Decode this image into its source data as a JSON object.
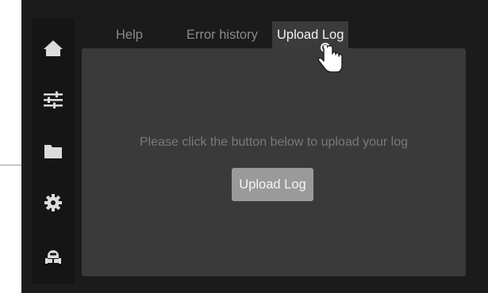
{
  "tabs": [
    {
      "label": "Help",
      "active": false
    },
    {
      "label": "Error history",
      "active": false
    },
    {
      "label": "Upload Log",
      "active": true
    }
  ],
  "sidebar": {
    "items": [
      {
        "icon": "home-icon"
      },
      {
        "icon": "sliders-icon"
      },
      {
        "icon": "folder-icon"
      },
      {
        "icon": "gear-icon"
      },
      {
        "icon": "robot-icon"
      }
    ]
  },
  "panel": {
    "message": "Please click the button below to upload your log",
    "button_label": "Upload Log"
  },
  "colors": {
    "background": "#1b1b1b",
    "panel": "#3a3a3a",
    "button": "#9a9a9a",
    "icon": "#dcdcdc"
  }
}
